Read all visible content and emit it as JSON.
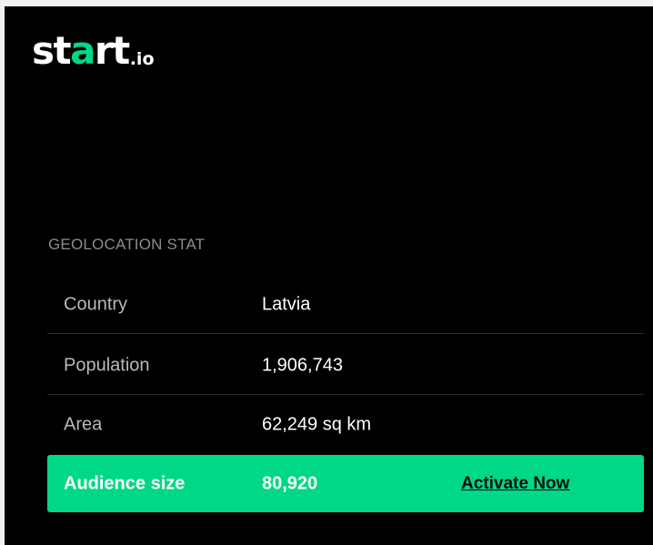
{
  "brand": {
    "logo_prefix": "st",
    "logo_accent": "a",
    "logo_suffix": "rt",
    "logo_tld": ".io",
    "accent_color": "#00d886"
  },
  "section": {
    "title": "GEOLOCATION STAT"
  },
  "stats": [
    {
      "label": "Country",
      "value": "Latvia"
    },
    {
      "label": "Population",
      "value": "1,906,743"
    },
    {
      "label": "Area",
      "value": "62,249 sq km"
    }
  ],
  "audience": {
    "label": "Audience size",
    "value": "80,920",
    "cta_label": "Activate Now"
  }
}
